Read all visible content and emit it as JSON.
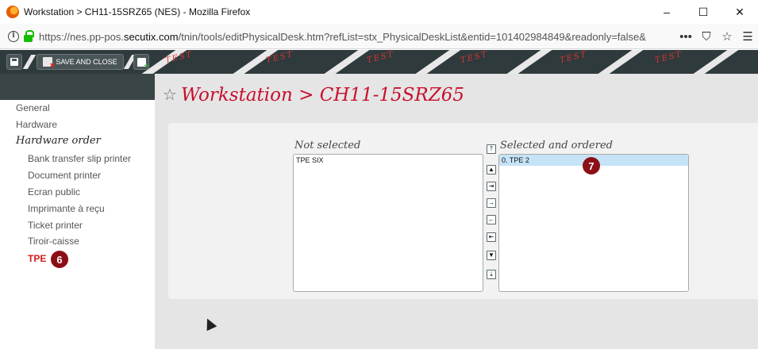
{
  "window": {
    "title": "Workstation > CH11-15SRZ65 (NES) - Mozilla Firefox",
    "minimize": "–",
    "maximize": "☐",
    "close": "✕"
  },
  "urlbar": {
    "url_prefix": "https://nes.pp-pos.",
    "url_domain": "secutix.com",
    "url_rest": "/tnin/tools/editPhysicalDesk.htm?refList=stx_PhysicalDeskList&entid=101402984849&readonly=false&",
    "more": "•••",
    "pocket": "⛉",
    "bookmark": "☆",
    "menu": "☰"
  },
  "toolbar": {
    "save_and_close_label": "SAVE AND CLOSE",
    "banner_text": "TEST"
  },
  "sidebar": {
    "items": [
      {
        "label": "General",
        "type": "top"
      },
      {
        "label": "Hardware",
        "type": "top"
      },
      {
        "label": "Hardware order",
        "type": "section"
      },
      {
        "label": "Bank transfer slip printer",
        "type": "sub"
      },
      {
        "label": "Document printer",
        "type": "sub"
      },
      {
        "label": "Ecran public",
        "type": "sub"
      },
      {
        "label": "Imprimante à reçu",
        "type": "sub"
      },
      {
        "label": "Ticket printer",
        "type": "sub"
      },
      {
        "label": "Tiroir-caisse",
        "type": "sub"
      },
      {
        "label": "TPE",
        "type": "active"
      }
    ]
  },
  "main": {
    "title": "Workstation > CH11-15SRZ65",
    "not_selected_label": "Not selected",
    "selected_label": "Selected and ordered",
    "not_selected_items": [
      "TPE SIX"
    ],
    "selected_items": [
      "0. TPE 2"
    ]
  },
  "callouts": {
    "sidebar": "6",
    "list": "7"
  },
  "colors": {
    "accent_red": "#c8102e",
    "callout": "#8b0f16",
    "selection": "#c6e3f7"
  }
}
